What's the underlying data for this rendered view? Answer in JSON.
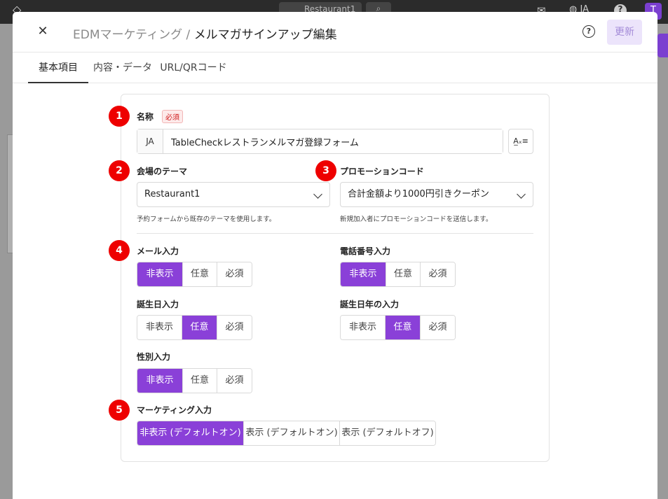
{
  "background": {
    "tab_label": "Restaurant1",
    "lang": "JA",
    "avatar_initial": "T"
  },
  "modal": {
    "close_glyph": "✕",
    "crumb": "EDMマーケティング / ",
    "title": "メルマガサインアップ編集",
    "help_glyph": "?",
    "update_label": "更新"
  },
  "tabs": [
    {
      "label": "基本項目",
      "active": true
    },
    {
      "label": "内容・データ",
      "active": false
    },
    {
      "label": "URL/QRコード",
      "active": false
    }
  ],
  "badges": [
    "1",
    "2",
    "3",
    "4",
    "5"
  ],
  "name": {
    "label": "名称",
    "required": "必須",
    "lang": "JA",
    "value": "TableCheckレストランメルマガ登録フォーム",
    "translate_glyph": "A̲ₓ≡"
  },
  "theme": {
    "label": "会場のテーマ",
    "value": "Restaurant1",
    "help": "予約フォームから既存のテーマを使用します。"
  },
  "promo": {
    "label": "プロモーションコード",
    "value": "合計金額より1000円引きクーポン",
    "help": "新規加入者にプロモーションコードを送信します。"
  },
  "options": [
    "非表示",
    "任意",
    "必須"
  ],
  "email_input": {
    "label": "メール入力",
    "selected": "非表示"
  },
  "phone_input": {
    "label": "電話番号入力",
    "selected": "非表示"
  },
  "birthday_input": {
    "label": "誕生日入力",
    "selected": "任意"
  },
  "birthyear_input": {
    "label": "誕生日年の入力",
    "selected": "任意"
  },
  "gender_input": {
    "label": "性別入力",
    "selected": "非表示"
  },
  "marketing_input": {
    "label": "マーケティング入力",
    "options": [
      "非表示 (デフォルトオン)",
      "表示 (デフォルトオン)",
      "表示 (デフォルトオフ)"
    ],
    "selected": "非表示 (デフォルトオン)"
  },
  "colors": {
    "accent": "#8a40d8",
    "badge": "#ee0000"
  }
}
